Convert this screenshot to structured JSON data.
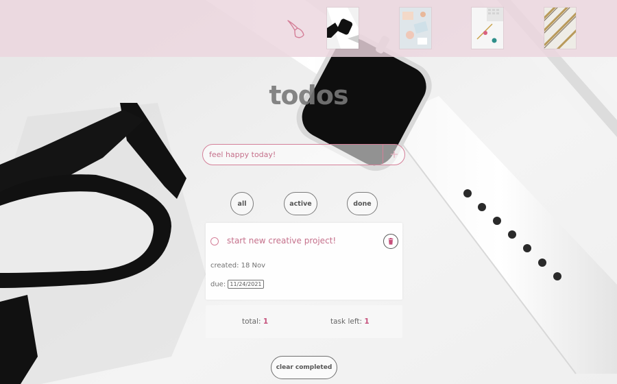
{
  "theme": {
    "accent": "#d47f98",
    "accent_text": "#c5708b",
    "count_color": "#c5507b",
    "topbar_bg": "#ecd6de"
  },
  "topbar": {
    "theme_icon": "paint-brush-icon",
    "backgrounds": [
      {
        "name": "background-thumb-watch-glasses"
      },
      {
        "name": "background-thumb-pastel-desk"
      },
      {
        "name": "background-thumb-white-keyboard"
      },
      {
        "name": "background-thumb-gold-stripes"
      }
    ]
  },
  "app": {
    "title": "todos",
    "input": {
      "value": "feel happy today!",
      "add_icon": "plus-icon"
    },
    "filters": {
      "all": "all",
      "active": "active",
      "done": "done"
    },
    "todo": {
      "text": "start new creative project!",
      "created_label": "created:",
      "created_value": "18 Nov",
      "due_label": "due:",
      "due_value": "11/24/2021",
      "delete_icon": "trash-icon"
    },
    "stats": {
      "total_label": "total:",
      "total_value": "1",
      "left_label": "task left:",
      "left_value": "1"
    },
    "clear_label": "clear completed"
  }
}
